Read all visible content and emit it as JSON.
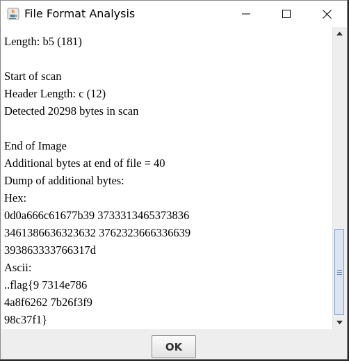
{
  "window": {
    "title": "File Format Analysis",
    "icon": "java-cup-icon",
    "controls": [
      "minimize-icon",
      "maximize-icon",
      "close-icon"
    ]
  },
  "content": {
    "lines": [
      "Length: b5 (181)",
      "",
      "Start of scan",
      "Header Length: c (12)",
      "Detected 20298 bytes in scan",
      "",
      "End of Image",
      "Additional bytes at end of file = 40",
      "Dump of additional bytes:",
      "Hex:",
      "0d0a666c61677b39 3733313465373836",
      "3461386636323632 3762323666336639",
      "393863333766317d",
      "Ascii:",
      "..flag{9 7314e786",
      "4a8f6262 7b26f3f9",
      "98c37f1}"
    ]
  },
  "scrollbar": {
    "position_fraction": 1.0
  },
  "buttons": {
    "ok_label": "OK"
  }
}
